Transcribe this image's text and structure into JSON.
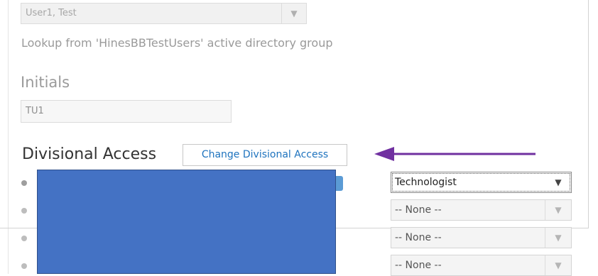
{
  "user_select": {
    "value": "User1, Test",
    "arrow_icon": "chevron-down-icon"
  },
  "help_text": "Lookup from 'HinesBBTestUsers' active directory group",
  "initials": {
    "label": "Initials",
    "value": "TU1"
  },
  "divisional_access": {
    "label": "Divisional Access",
    "change_button_label": "Change Divisional Access"
  },
  "annotation": {
    "color": "#7030a0"
  },
  "redaction": {
    "color": "#4472c4"
  },
  "roles": [
    {
      "value": "Technologist",
      "active": true
    },
    {
      "value": "-- None --",
      "active": false
    },
    {
      "value": "-- None --",
      "active": false
    },
    {
      "value": "-- None --",
      "active": false
    }
  ]
}
